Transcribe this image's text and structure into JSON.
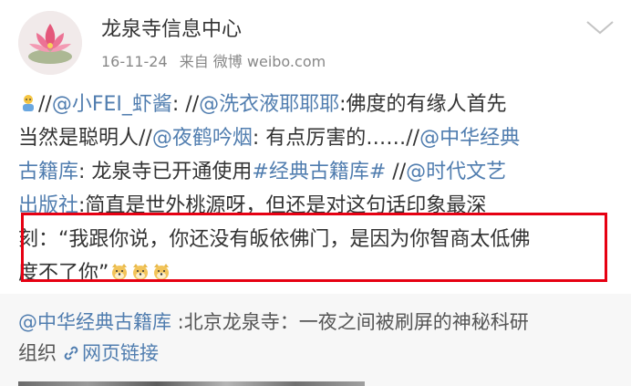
{
  "header": {
    "user_name": "龙泉寺信息中心",
    "date": "16-11-24",
    "source": "来自 微博 weibo.com"
  },
  "post": {
    "line1": [
      {
        "t": "//",
        "k": "text"
      },
      {
        "t": "@小FEI_虾酱",
        "k": "mention"
      },
      {
        "t": ": //",
        "k": "text"
      },
      {
        "t": "@洗衣液耶耶耶",
        "k": "mention"
      },
      {
        "t": ":佛度的有缘人首先",
        "k": "text"
      }
    ],
    "line2": [
      {
        "t": "当然是聪明人//",
        "k": "text"
      },
      {
        "t": "@夜鹤吟烟",
        "k": "mention"
      },
      {
        "t": ": 有点厉害的……//",
        "k": "text"
      },
      {
        "t": "@中华经典",
        "k": "mention"
      }
    ],
    "line3": [
      {
        "t": "古籍库",
        "k": "mention"
      },
      {
        "t": ": 龙泉寺已开通使用",
        "k": "text"
      },
      {
        "t": "#经典古籍库#",
        "k": "topic"
      },
      {
        "t": " //",
        "k": "text"
      },
      {
        "t": "@时代文艺",
        "k": "mention"
      }
    ],
    "line4": [
      {
        "t": "出版社",
        "k": "mention"
      },
      {
        "t": ":简直是世外桃源呀，但还是对这句话印象最深",
        "k": "text"
      }
    ],
    "line5": [
      {
        "t": "刻：“我跟你说，你还没有皈依佛门，是因为你智商太低佛",
        "k": "text"
      }
    ],
    "line6": [
      {
        "t": "度不了你”",
        "k": "text"
      }
    ],
    "emoji_names": [
      "doge-emoji",
      "doge-emoji",
      "doge-emoji"
    ]
  },
  "repost": {
    "author": "@中华经典古籍库",
    "text_line1": " :北京龙泉寺：一夜之间被刷屏的神秘科研",
    "text_line2": "组织",
    "link_label": "网页链接"
  },
  "colors": {
    "link": "#507daf",
    "highlight_border": "#e60012",
    "repost_bg": "#f7f7f7"
  }
}
